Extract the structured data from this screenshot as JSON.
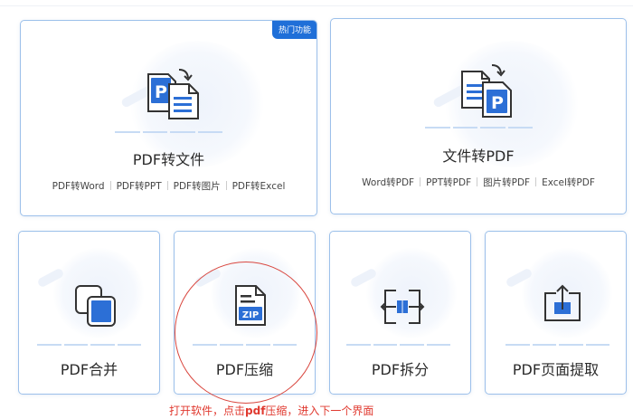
{
  "colors": {
    "accent": "#1f6fd8",
    "border": "#9cc0ea",
    "annotation": "#d9473f"
  },
  "cards": {
    "pdf_to_file": {
      "icon": "pdf-to-file-icon",
      "badge": "热门功能",
      "title": "PDF转文件",
      "subs": [
        "PDF转Word",
        "PDF转PPT",
        "PDF转图片",
        "PDF转Excel"
      ]
    },
    "file_to_pdf": {
      "icon": "file-to-pdf-icon",
      "title": "文件转PDF",
      "subs": [
        "Word转PDF",
        "PPT转PDF",
        "图片转PDF",
        "Excel转PDF"
      ]
    },
    "merge": {
      "icon": "merge-icon",
      "title": "PDF合并"
    },
    "compress": {
      "icon": "zip-file-icon",
      "icon_label": "ZIP",
      "title": "PDF压缩"
    },
    "split": {
      "icon": "split-icon",
      "title": "PDF拆分"
    },
    "extract": {
      "icon": "extract-page-icon",
      "title": "PDF页面提取"
    }
  },
  "annotation": {
    "caption_before": "打开软件，点击",
    "caption_bold": "pdf",
    "caption_after": "压缩，进入下一个界面"
  }
}
